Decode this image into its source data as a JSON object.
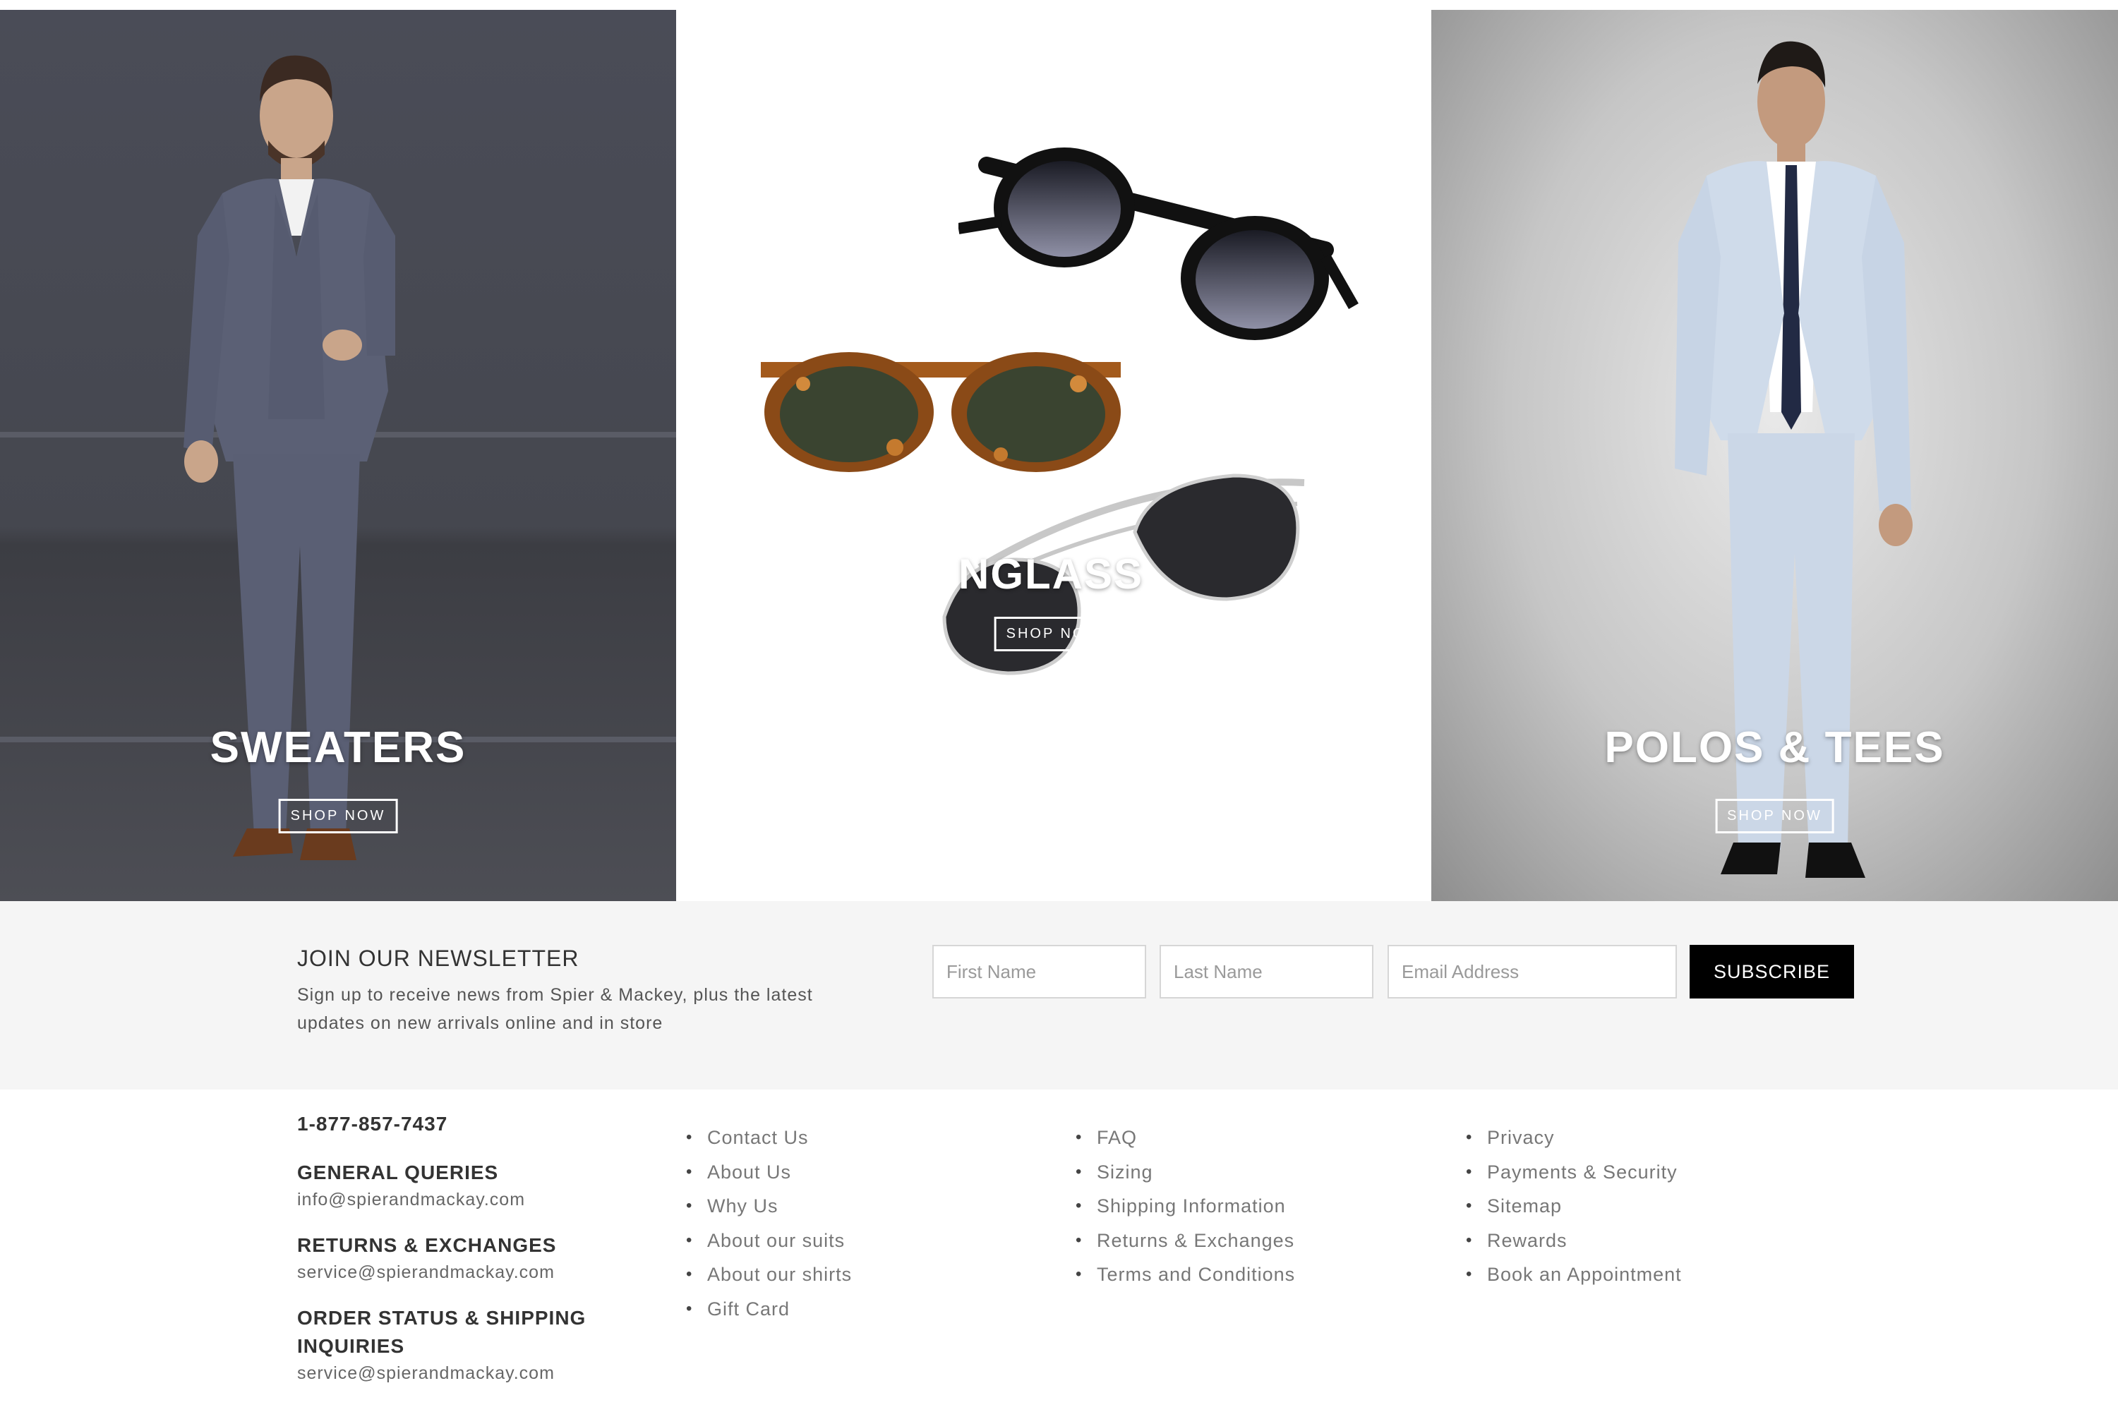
{
  "hero": {
    "tiles": [
      {
        "title": "SWEATERS",
        "button": "SHOP NOW"
      },
      {
        "title": "NGLASS",
        "button": "SHOP NOW"
      },
      {
        "title": "POLOS & TEES",
        "button": "SHOP NOW"
      }
    ]
  },
  "newsletter": {
    "title": "JOIN OUR NEWSLETTER",
    "desc_line1": "Sign up to receive news from Spier & Mackey, plus the latest",
    "desc_line2": "updates on new arrivals online and in store",
    "first_name_placeholder": "First Name",
    "last_name_placeholder": "Last Name",
    "email_placeholder": "Email Address",
    "subscribe_label": "SUBSCRIBE"
  },
  "footer": {
    "phone": "1-877-857-7437",
    "contacts": [
      {
        "heading": "GENERAL QUERIES",
        "email": "info@spierandmackay.com"
      },
      {
        "heading": "RETURNS & EXCHANGES",
        "email": "service@spierandmackay.com"
      },
      {
        "heading_line1": "ORDER STATUS & SHIPPING",
        "heading_line2": "INQUIRIES",
        "email": "service@spierandmackay.com"
      }
    ],
    "col1": [
      "Contact Us",
      "About Us",
      "Why Us",
      "About our suits",
      "About our shirts",
      "Gift Card"
    ],
    "col2": [
      "FAQ",
      "Sizing",
      "Shipping Information",
      "Returns & Exchanges",
      "Terms and Conditions"
    ],
    "col3": [
      "Privacy",
      "Payments & Security",
      "Sitemap",
      "Rewards",
      "Book an Appointment"
    ]
  }
}
